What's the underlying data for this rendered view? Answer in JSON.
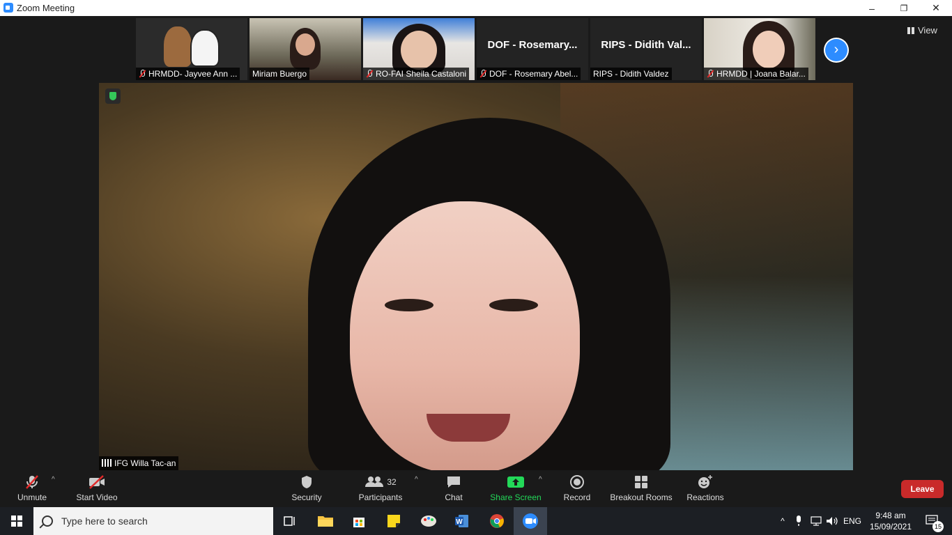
{
  "window": {
    "title": "Zoom Meeting",
    "minimize_glyph": "–",
    "restore_glyph": "❐",
    "close_glyph": "✕"
  },
  "gallery": {
    "participants": [
      {
        "name": "HRMDD- Jayvee Ann ...",
        "muted": true,
        "video": "cartoon-bears"
      },
      {
        "name": "Miriam Buergo",
        "muted": false,
        "video": "camera"
      },
      {
        "name": "RO-FAI Sheila Castaloni",
        "muted": true,
        "video": "camera"
      },
      {
        "name": "DOF - Rosemary Abel...",
        "muted": true,
        "big_label": "DOF - Rosemary..."
      },
      {
        "name": "RIPS - Didith Valdez",
        "muted": false,
        "big_label": "RIPS - Didith Val..."
      },
      {
        "name": "HRMDD | Joana Balar...",
        "muted": true,
        "video": "camera"
      }
    ],
    "next_icon": "chevron-right-icon",
    "view_label": "View"
  },
  "speaker": {
    "name": "IFG Willa Tac-an"
  },
  "toolbar": {
    "unmute": "Unmute",
    "start_video": "Start Video",
    "security": "Security",
    "participants": "Participants",
    "participants_count": "32",
    "chat": "Chat",
    "share_screen": "Share Screen",
    "record": "Record",
    "breakout_rooms": "Breakout Rooms",
    "reactions": "Reactions",
    "leave": "Leave"
  },
  "taskbar": {
    "search_placeholder": "Type here to search",
    "language": "ENG",
    "time": "9:48 am",
    "date": "15/09/2021",
    "notifications": "15"
  },
  "colors": {
    "accent": "#2d8cff",
    "leave": "#c92a2a",
    "share": "#23d959",
    "security_ok": "#34c759"
  }
}
